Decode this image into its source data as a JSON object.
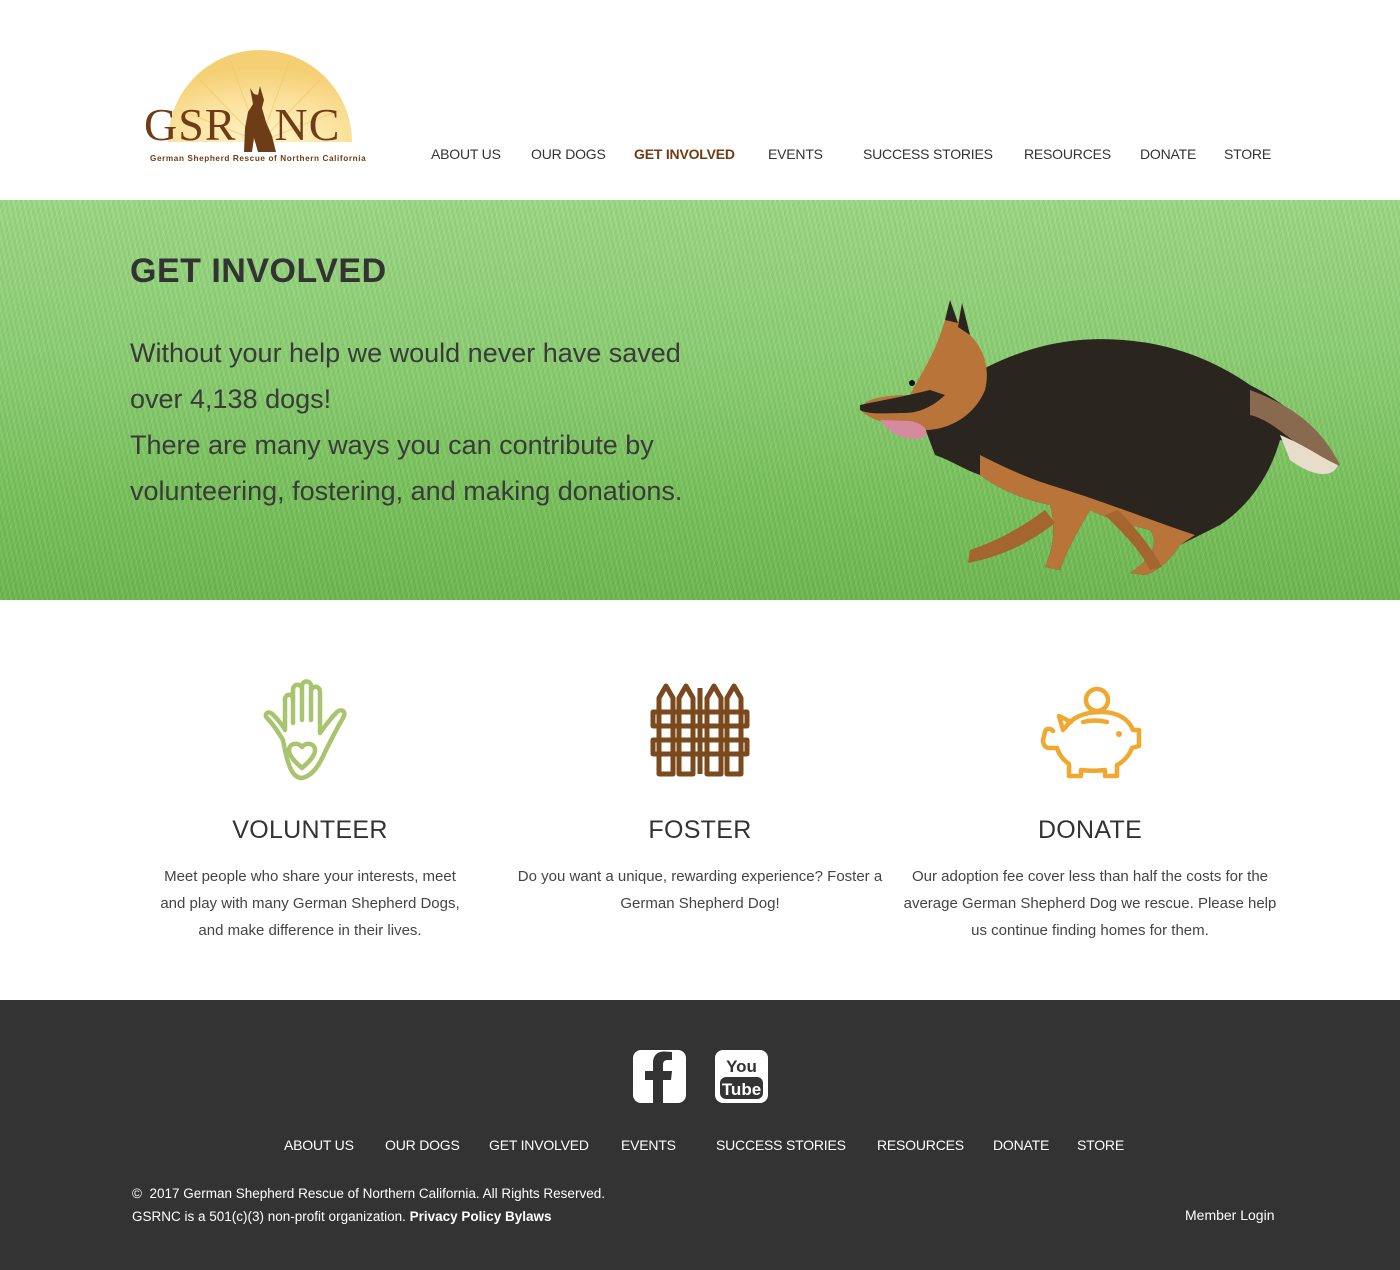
{
  "header": {
    "logo": {
      "wordmark_left": "GSR",
      "wordmark_right": "NC",
      "tagline": "German Shepherd Rescue of Northern California"
    },
    "nav": [
      {
        "label": "ABOUT US",
        "active": false
      },
      {
        "label": "OUR DOGS",
        "active": false
      },
      {
        "label": "GET INVOLVED",
        "active": true
      },
      {
        "label": "EVENTS",
        "active": false
      },
      {
        "label": "SUCCESS STORIES",
        "active": false
      },
      {
        "label": "RESOURCES",
        "active": false
      },
      {
        "label": "DONATE",
        "active": false
      },
      {
        "label": "STORE",
        "active": false
      }
    ]
  },
  "hero": {
    "title": "GET INVOLVED",
    "line1": "Without your help we would never have saved",
    "line2": "over 4,138 dogs!",
    "line3": "There are many ways you can contribute by",
    "line4": "volunteering, fostering, and making donations."
  },
  "cards": [
    {
      "icon": "hand-heart-icon",
      "title": "VOLUNTEER",
      "text_lines": [
        "Meet people who share your interests, meet",
        "and play with many German Shepherd Dogs,",
        "and make difference in their lives."
      ]
    },
    {
      "icon": "fence-icon",
      "title": "FOSTER",
      "text_lines": [
        "Do you want a unique, rewarding experience? Foster a",
        "German Shepherd Dog!"
      ]
    },
    {
      "icon": "piggy-bank-icon",
      "title": "DONATE",
      "text_lines": [
        "Our adoption fee cover less than half the costs for the",
        "average German Shepherd Dog we rescue. Please help",
        "us continue finding homes for them."
      ]
    }
  ],
  "footer": {
    "social": [
      {
        "icon": "facebook-icon"
      },
      {
        "icon": "youtube-icon",
        "label_top": "You",
        "label_bottom": "Tube"
      }
    ],
    "nav": [
      "ABOUT US",
      "OUR DOGS",
      "GET INVOLVED",
      "EVENTS",
      "SUCCESS STORIES",
      "RESOURCES",
      "DONATE",
      "STORE"
    ],
    "copyright_symbol": "©",
    "copyright": "2017 German Shepherd Rescue of Northern California. All Rights Reserved.",
    "nonprofit": "GSRNC is a 501(c)(3) non-profit organization.",
    "privacy_link": "Privacy Policy",
    "bylaws_link": "Bylaws",
    "member_login": "Member Login"
  },
  "colors": {
    "brand_brown": "#6e3d17",
    "volunteer_green": "#a8c46e",
    "foster_brown": "#7a4a1e",
    "donate_orange": "#f0a830",
    "footer_bg": "#333333"
  }
}
